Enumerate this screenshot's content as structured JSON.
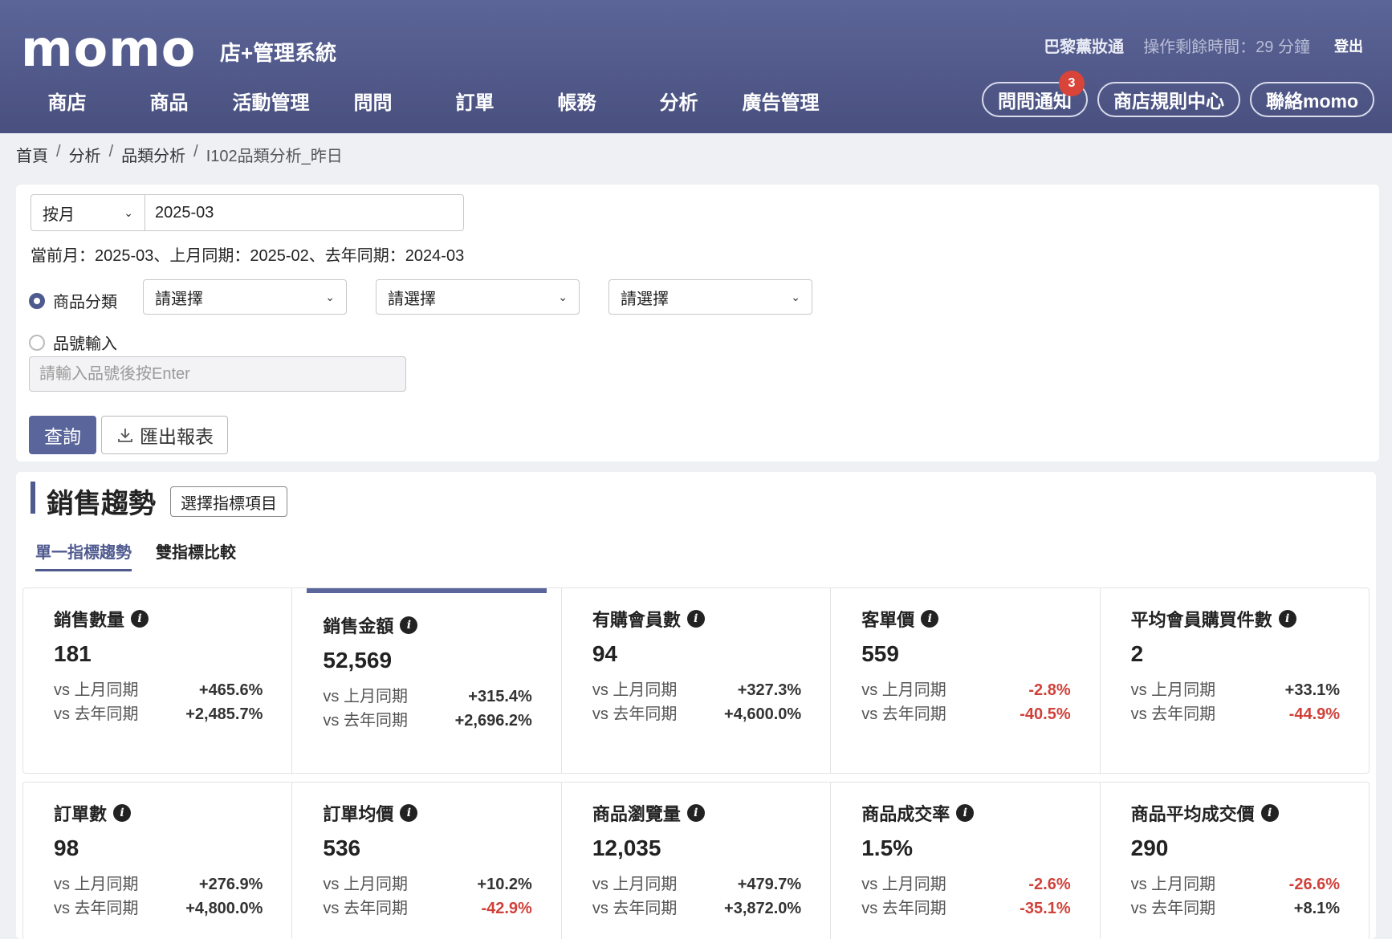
{
  "header": {
    "logo": "momo",
    "subtitle": "店+管理系統",
    "store_name": "巴黎薰妝通",
    "timer": "操作剩餘時間：29 分鐘",
    "logout": "登出",
    "nav": [
      "商店",
      "商品",
      "活動管理",
      "問問",
      "訂單",
      "帳務",
      "分析",
      "廣告管理"
    ],
    "buttons": {
      "notify": "問問通知",
      "notify_badge": "3",
      "rules": "商店規則中心",
      "contact": "聯絡momo"
    }
  },
  "breadcrumb": [
    "首頁",
    "分析",
    "品類分析",
    "I102品類分析_昨日"
  ],
  "filter": {
    "period_type": "按月",
    "period_value": "2025-03",
    "date_info": "當前月：2025-03、上月同期：2025-02、去年同期：2024-03",
    "radio_category": "商品分類",
    "select_placeholder": "請選擇",
    "radio_sku": "品號輸入",
    "sku_placeholder": "請輸入品號後按Enter",
    "query_button": "查詢",
    "export_button": "匯出報表"
  },
  "trend": {
    "title": "銷售趨勢",
    "metric_button": "選擇指標項目",
    "tabs": [
      "單一指標趨勢",
      "雙指標比較"
    ],
    "cmp_prev_month": "vs 上月同期",
    "cmp_prev_year": "vs 去年同期",
    "cards": [
      {
        "title": "銷售數量",
        "value": "181",
        "mom": "+465.6%",
        "yoy": "+2,485.7%"
      },
      {
        "title": "銷售金額",
        "value": "52,569",
        "mom": "+315.4%",
        "yoy": "+2,696.2%"
      },
      {
        "title": "有購會員數",
        "value": "94",
        "mom": "+327.3%",
        "yoy": "+4,600.0%"
      },
      {
        "title": "客單價",
        "value": "559",
        "mom": "-2.8%",
        "yoy": "-40.5%"
      },
      {
        "title": "平均會員購買件數",
        "value": "2",
        "mom": "+33.1%",
        "yoy": "-44.9%"
      },
      {
        "title": "訂單數",
        "value": "98",
        "mom": "+276.9%",
        "yoy": "+4,800.0%"
      },
      {
        "title": "訂單均價",
        "value": "536",
        "mom": "+10.2%",
        "yoy": "-42.9%"
      },
      {
        "title": "商品瀏覽量",
        "value": "12,035",
        "mom": "+479.7%",
        "yoy": "+3,872.0%"
      },
      {
        "title": "商品成交率",
        "value": "1.5%",
        "mom": "-2.6%",
        "yoy": "-35.1%"
      },
      {
        "title": "商品平均成交價",
        "value": "290",
        "mom": "-26.6%",
        "yoy": "+8.1%"
      }
    ]
  },
  "colors": {
    "header": "#4f5788",
    "accent": "#5a659b",
    "negative": "#d0413a"
  }
}
